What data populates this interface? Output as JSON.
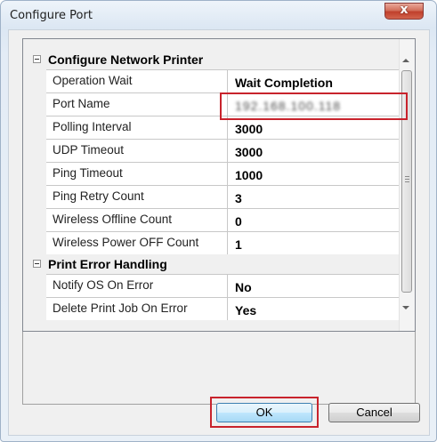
{
  "window": {
    "title": "Configure Port",
    "close_glyph": "x"
  },
  "grid": {
    "categories": [
      {
        "label": "Configure Network Printer",
        "properties": [
          {
            "name": "Operation Wait",
            "value": "Wait Completion"
          },
          {
            "name": "Port Name",
            "value": "192.168.100.118"
          },
          {
            "name": "Polling Interval",
            "value": "3000"
          },
          {
            "name": "UDP Timeout",
            "value": "3000"
          },
          {
            "name": "Ping Timeout",
            "value": "1000"
          },
          {
            "name": "Ping Retry Count",
            "value": "3"
          },
          {
            "name": "Wireless Offline Count",
            "value": "0"
          },
          {
            "name": "Wireless Power OFF Count",
            "value": "1"
          }
        ]
      },
      {
        "label": "Print Error Handling",
        "properties": [
          {
            "name": "Notify OS On Error",
            "value": "No"
          },
          {
            "name": "Delete Print Job On Error",
            "value": "Yes"
          }
        ]
      }
    ]
  },
  "buttons": {
    "ok": "OK",
    "cancel": "Cancel"
  },
  "colors": {
    "highlight": "#c8232c",
    "close_button": "#c0402c"
  }
}
